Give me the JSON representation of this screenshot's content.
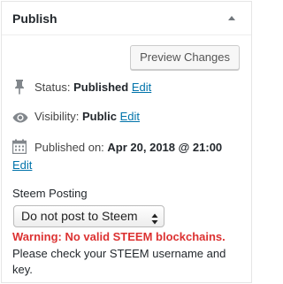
{
  "panel": {
    "title": "Publish"
  },
  "actions": {
    "preview_label": "Preview Changes"
  },
  "status": {
    "label": "Status:",
    "value": "Published",
    "edit_label": "Edit"
  },
  "visibility": {
    "label": "Visibility:",
    "value": "Public",
    "edit_label": "Edit"
  },
  "published": {
    "label": "Published on:",
    "value": "Apr 20, 2018 @ 21:00",
    "edit_label": "Edit"
  },
  "steem": {
    "section_label": "Steem Posting",
    "select_value": "Do not post to Steem",
    "warning": "Warning: No valid STEEM blockchains.",
    "notice": "Please check your STEEM username and key."
  },
  "colors": {
    "link": "#0073aa",
    "warning": "#dc3232",
    "border": "#e5e5e5"
  },
  "icons": {
    "toggle": "triangle-up-icon",
    "status": "pin-icon",
    "visibility": "eye-icon",
    "published": "calendar-icon",
    "select": "select-arrows-icon"
  }
}
